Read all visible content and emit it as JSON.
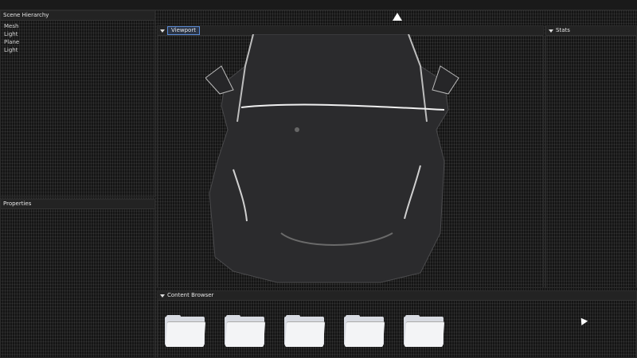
{
  "panels": {
    "scene_hierarchy": {
      "title": "Scene Hierarchy",
      "items": [
        "Mesh",
        "Light",
        "Plane",
        "Light"
      ]
    },
    "properties": {
      "title": "Properties"
    },
    "viewport": {
      "tab": "Viewport"
    },
    "stats": {
      "title": "Stats"
    },
    "content_browser": {
      "title": "Content Browser",
      "folders": [
        "",
        "",
        "",
        "",
        ""
      ]
    }
  }
}
